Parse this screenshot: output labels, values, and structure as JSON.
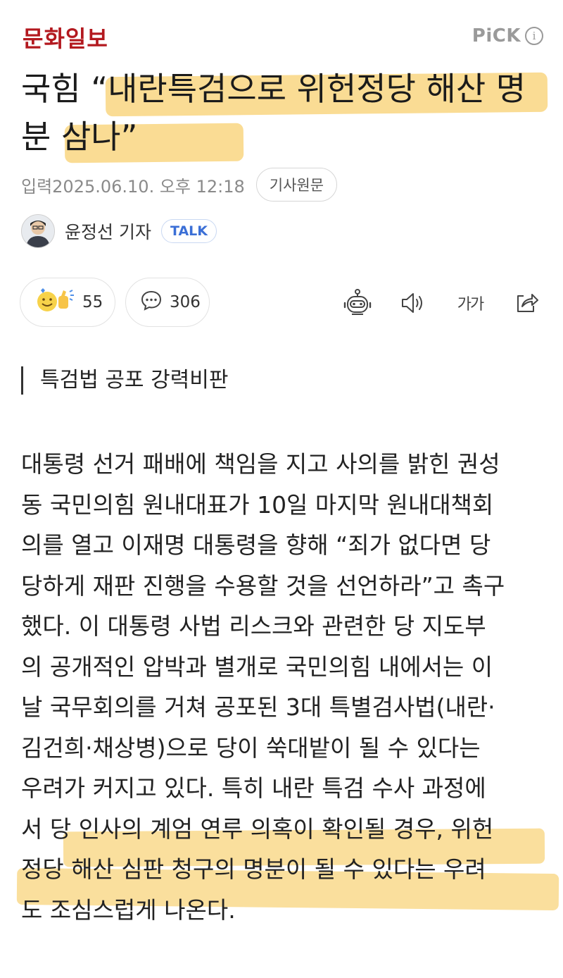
{
  "header": {
    "logo": "문화일보",
    "pick_label": "PiCK",
    "info_label": "i"
  },
  "headline": "국힘 “내란특검으로 위헌정당 해산 명분 삼나”",
  "meta": {
    "date": "입력2025.06.10. 오후 12:18",
    "origin_button": "기사원문"
  },
  "reporter": {
    "name": "윤정선 기자",
    "badge": "TALK"
  },
  "actions": {
    "reaction_count": "55",
    "comment_count": "306",
    "tools": [
      "robot-summary-icon",
      "speaker-icon",
      "font-size-icon",
      "share-icon"
    ],
    "font_size_label": "가가"
  },
  "subheading": "특검법 공포 강력비판",
  "body_lines": [
    "대통령 선거 패배에 책임을 지고 사의를 밝힌 권성",
    "동 국민의힘 원내대표가 10일 마지막 원내대책회",
    "의를 열고 이재명 대통령을 향해 “죄가 없다면 당",
    "당하게 재판 진행을 수용할 것을 선언하라”고 촉구",
    "했다. 이 대통령 사법 리스크와 관련한 당 지도부",
    "의 공개적인 압박과 별개로 국민의힘 내에서는 이",
    "날 국무회의를 거쳐 공포된 3대 특별검사법(내란·",
    "김건희·채상병)으로 당이 쑥대밭이 될 수 있다는",
    "우려가 커지고 있다. 특히 내란 특검 수사 과정에",
    "서 당 인사의 계엄 연루 의혹이 확인될 경우, 위헌",
    "정당 해산 심판 청구의 명분이 될 수 있다는 우려",
    "도 조심스럽게 나온다."
  ],
  "colors": {
    "logo": "#b3191f",
    "highlight": "#f5c03c",
    "talk": "#3b6fd6"
  }
}
